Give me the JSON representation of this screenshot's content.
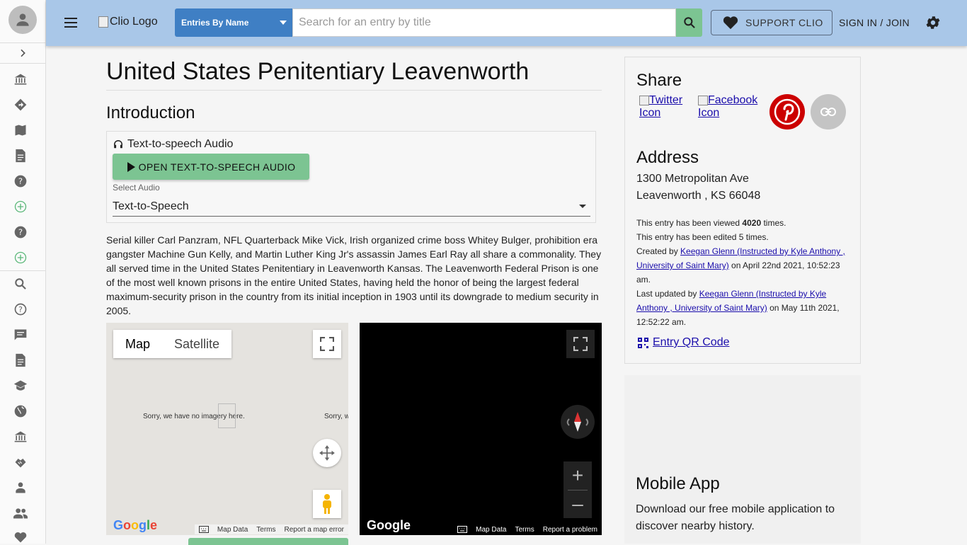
{
  "header": {
    "logo_text": "Clio Logo",
    "search_type": "Entries By Name",
    "search_placeholder": "Search for an entry by title",
    "support_label": "SUPPORT CLIO",
    "signin_label": "SIGN IN / JOIN"
  },
  "sidebar": {
    "icons": [
      "avatar-icon",
      "chevron-right-icon",
      "museum-icon",
      "directions-icon",
      "map-book-icon",
      "document-icon",
      "help-icon",
      "add-circle-icon",
      "help-icon",
      "add-circle-icon",
      "search-icon",
      "help-outline-icon",
      "chat-icon",
      "document-icon",
      "school-icon",
      "globe-icon",
      "museum-icon",
      "handshake-icon",
      "person-icon",
      "people-icon",
      "heart-icon"
    ]
  },
  "entry": {
    "title": "United States Penitentiary Leavenworth",
    "intro_heading": "Introduction",
    "tts_label": "Text-to-speech Audio",
    "tts_button": "OPEN TEXT-TO-SPEECH AUDIO",
    "select_label": "Select Audio",
    "select_value": "Text-to-Speech",
    "body": "Serial killer Carl Panzram, NFL Quarterback Mike Vick, Irish organized crime boss Whitey Bulger, prohibition era gangster Machine Gun Kelly, and Martin Luther King Jr's assassin James Earl Ray all share a commonality. They all served time in the United States Penitentiary in Leavenworth Kansas. The Leavenworth Federal Prison is one of the most well known prisons in the entire United States, having held the honor of being the largest federal maximum-security prison in the country from its initial inception in 1903 until its downgrade to medium security in 2005."
  },
  "map": {
    "tab_map": "Map",
    "tab_satellite": "Satellite",
    "no_imagery": "Sorry, we have no imagery here.",
    "no_imagery_partial": "Sorry, w",
    "google": "Google",
    "map_data": "Map Data",
    "terms": "Terms",
    "report_map": "Report a map error",
    "report_problem": "Report a problem"
  },
  "share": {
    "heading": "Share",
    "twitter": "Twitter Icon",
    "facebook": "Facebook Icon"
  },
  "address": {
    "heading": "Address",
    "line1": "1300 Metropolitan Ave",
    "line2": "Leavenworth , KS 66048"
  },
  "meta": {
    "viewed_prefix": "This entry has been viewed ",
    "viewed_count": "4020",
    "viewed_suffix": " times.",
    "edited": "This entry has been edited 5 times.",
    "created_prefix": "Created by ",
    "created_by": "Keegan Glenn (Instructed by Kyle Anthony , University of Saint Mary)",
    "created_suffix": " on April 22nd 2021, 10:52:23 am.",
    "updated_prefix": "Last updated by ",
    "updated_by": "Keegan Glenn (Instructed by Kyle Anthony , University of Saint Mary)",
    "updated_suffix": " on May 11th 2021, 12:52:22 am.",
    "qr": "Entry QR Code"
  },
  "mobile": {
    "heading": "Mobile App",
    "text": "Download our free mobile application to discover nearby history."
  }
}
